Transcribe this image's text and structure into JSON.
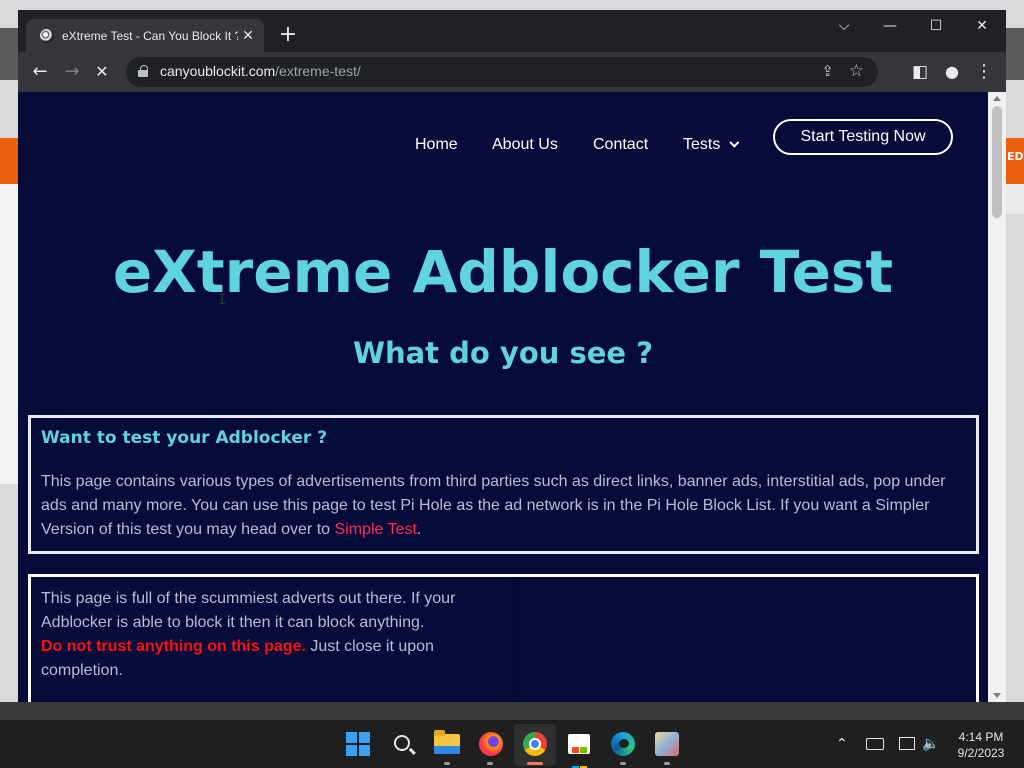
{
  "browser": {
    "tab": {
      "title": "eXtreme Test - Can You Block It ?",
      "close": "✕"
    },
    "new_tab": "+",
    "window_controls": {
      "dropdown": "⌵",
      "minimize": "—",
      "maximize": "☐",
      "close": "✕"
    },
    "toolbar": {
      "back": "←",
      "forward": "→",
      "reload": "✕",
      "side_panel": "◧",
      "profile": "●",
      "menu": "⋮"
    },
    "url": {
      "host": "canyoublockit.com",
      "path": "/extreme-test/"
    },
    "omnibox_icons": {
      "share": "⇪",
      "bookmark": "☆"
    }
  },
  "page": {
    "nav": {
      "items": [
        "Home",
        "About Us",
        "Contact",
        "Tests"
      ],
      "cta": "Start Testing Now"
    },
    "hero_title": "eXtreme Adblocker Test",
    "hero_subtitle": "What do you see ?",
    "box1": {
      "heading": "Want to test your Adblocker ?",
      "text": "This page contains various types of advertisements from third parties such as direct links, banner ads, interstitial ads, pop under ads and many more. You can use this page to test Pi Hole as the ad network is in the Pi Hole Block List. If you want a Simpler Version of this test you may head over to ",
      "link": "Simple Test",
      "text_end": "."
    },
    "box2": {
      "text": "This page is full of the scummiest adverts out there. If your Adblocker is able to block it then it can block anything.",
      "warning": "Do not trust anything on this page.",
      "text_end": " Just close it upon completion."
    }
  },
  "desktop": {
    "partial_text": "ED"
  },
  "taskbar": {
    "icons": [
      "windows-start-icon",
      "search-icon",
      "file-explorer-icon",
      "firefox-icon",
      "chrome-icon",
      "microsoft-store-icon",
      "edge-icon",
      "game-icon"
    ],
    "tray": {
      "chevron": "⌃",
      "volume": "🔈"
    },
    "time": "4:14 PM",
    "date": "9/2/2023"
  },
  "colors": {
    "page_bg": "#060b3a",
    "accent": "#5fd3e0",
    "link": "#ff2a55",
    "warning": "#ff1010"
  }
}
